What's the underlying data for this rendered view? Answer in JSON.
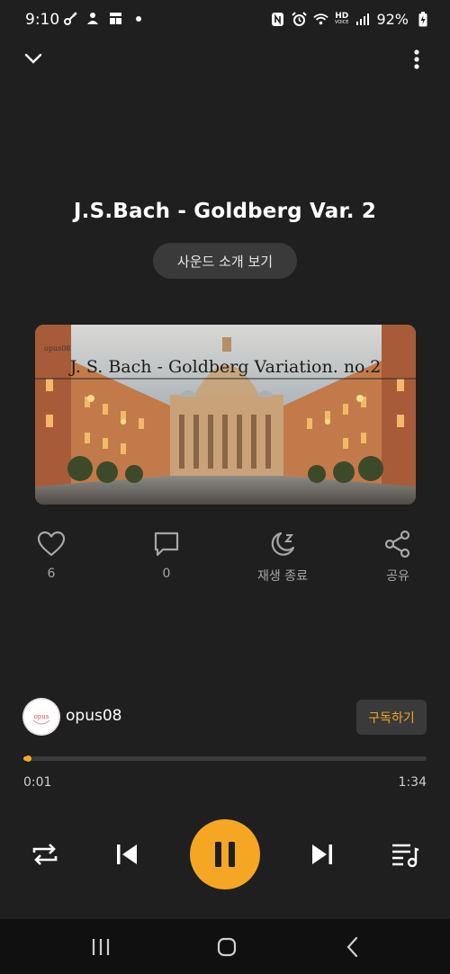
{
  "status_bar": {
    "time": "9:10",
    "battery": "92%",
    "left_icons": [
      "vpn-key-icon",
      "person-alert-icon",
      "grid-icon",
      "dot-icon"
    ],
    "right_icons": [
      "nfc-icon",
      "alarm-icon",
      "wifi-icon",
      "hd-voice-icon",
      "signal-icon",
      "battery-icon"
    ],
    "hd_label": "HD",
    "voice_label": "VOICE"
  },
  "player": {
    "title": "J.S.Bach - Goldberg Var. 2",
    "intro_label": "사운드 소개 보기",
    "album_art_caption": "J. S. Bach - Goldberg Variation. no.2",
    "album_art_tag": "opus08"
  },
  "actions": [
    {
      "icon": "heart-icon",
      "label": "6"
    },
    {
      "icon": "comment-icon",
      "label": "0"
    },
    {
      "icon": "sleep-timer-icon",
      "label": "재생 종료"
    },
    {
      "icon": "share-icon",
      "label": "공유"
    }
  ],
  "channel": {
    "name": "opus08",
    "avatar_text": "opus",
    "subscribe_label": "구독하기"
  },
  "progress": {
    "current": "0:01",
    "total": "1:34",
    "fraction": 0.011
  },
  "colors": {
    "accent": "#f5a623",
    "background": "#1f1f1f",
    "button_bg": "#3a3a3a"
  },
  "controls": [
    "repeat-icon",
    "previous-icon",
    "pause-icon",
    "next-icon",
    "playlist-icon"
  ],
  "nav": [
    "recent-apps-icon",
    "home-icon",
    "back-icon"
  ]
}
